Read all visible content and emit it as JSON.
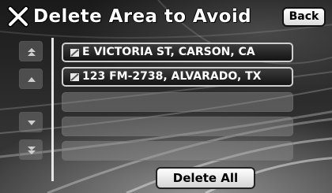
{
  "header": {
    "title": "Delete Area to Avoid",
    "icon": "cancel-x-icon",
    "back_label": "Back"
  },
  "scroll_controls": [
    {
      "name": "page-up-button",
      "icon": "double-up-arrow-icon"
    },
    {
      "name": "up-button",
      "icon": "up-arrow-icon"
    },
    {
      "name": "down-button",
      "icon": "down-arrow-icon"
    },
    {
      "name": "page-down-button",
      "icon": "double-down-arrow-icon"
    }
  ],
  "areas": [
    {
      "label": "E VICTORIA ST, CARSON, CA",
      "icon": "area-icon"
    },
    {
      "label": "123 FM-2738, ALVARADO, TX",
      "icon": "area-icon"
    }
  ],
  "empty_rows": 3,
  "footer": {
    "delete_all_label": "Delete All"
  },
  "colors": {
    "text": "#ffffff",
    "button_face": "#ffffff",
    "divider": "#e6e6e6"
  }
}
